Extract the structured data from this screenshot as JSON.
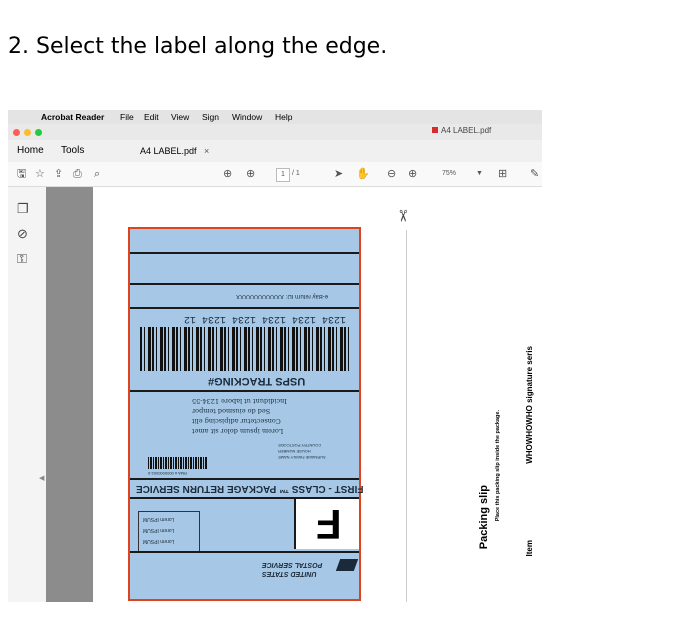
{
  "step_title": "2.  Select the label along the edge.",
  "menubar": {
    "app_name": "Acrobat Reader",
    "items": [
      "File",
      "Edit",
      "View",
      "Sign",
      "Window",
      "Help"
    ]
  },
  "window": {
    "doc_title": "A4 LABEL.pdf"
  },
  "tabs": {
    "home": "Home",
    "tools": "Tools",
    "doc_tab": "A4 LABEL.pdf",
    "close": "×"
  },
  "toolbar": {
    "page_current": "1",
    "page_total": "/ 1",
    "zoom": "75%"
  },
  "label": {
    "return_id": "e-Bay return ID: XXXXXXXXXXXX",
    "tracking_number": "1234 1234 1234 1234 1234 12",
    "tracking_title": "USPS TRACKING#",
    "lorem_lines": [
      "Lorem ipsum dolor sit amet",
      "Consectetur adipiscing elit",
      "Sed do eiusmod tempor",
      "Incididunt ut labore   1234-55"
    ],
    "address_lines": [
      "SURNAME FAMILY NAME",
      "HOUSE NUMBER",
      "COUNTRY POSTCODE"
    ],
    "rma": "RMA # 0000000002-0",
    "service": "FIRST - CLASS ™ PACKAGE RETURN SERVICE",
    "service_letter": "F",
    "lorem_box": [
      "Lorem IPSUM",
      "Lorem IPSUM",
      "Lorem IPSUM"
    ],
    "usps_line1": "UNITED STATES",
    "usps_line2": "POSTAL SERVICE"
  },
  "packing_slip": {
    "title": "Packing slip",
    "subtitle": "Place this packing slip inside the package.",
    "item_header": "Item",
    "item_value": "WHOWHOWHO signature seris"
  },
  "colors": {
    "label_fill": "#a6c8e6",
    "label_border": "#e0421e"
  }
}
